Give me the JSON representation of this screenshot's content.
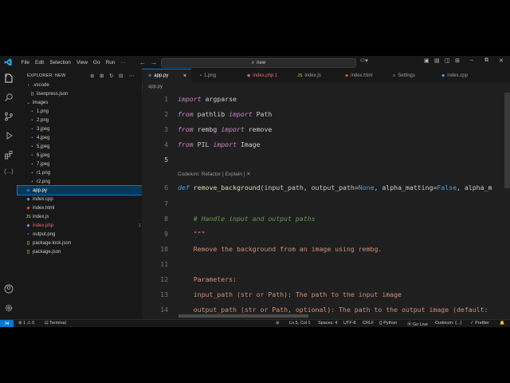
{
  "titlebar": {
    "menu": [
      "File",
      "Edit",
      "Selection",
      "View",
      "Go",
      "Run"
    ],
    "ellipsis": "···",
    "search_text": "new",
    "colors": {
      "accent": "#0078d4",
      "logo": "#23a9f2"
    }
  },
  "activity": {
    "icons": [
      "explorer-icon",
      "search-icon",
      "source-control-icon",
      "run-debug-icon",
      "extensions-icon",
      "codeium-icon",
      "account-icon",
      "manage-gear-icon"
    ]
  },
  "sidebar": {
    "title": "EXPLORER: NEW",
    "tree": [
      {
        "label": ".vscode",
        "icon": "›",
        "indent": 1,
        "type": "folder"
      },
      {
        "label": "iisexpress.json",
        "icon": "{}",
        "indent": 2,
        "type": "json"
      },
      {
        "label": "images",
        "icon": "⌄",
        "indent": 1,
        "type": "folder"
      },
      {
        "label": "1.png",
        "icon": "▪",
        "indent": 2,
        "type": "image"
      },
      {
        "label": "2.png",
        "icon": "▪",
        "indent": 2,
        "type": "image"
      },
      {
        "label": "3.jpeg",
        "icon": "▪",
        "indent": 2,
        "type": "image"
      },
      {
        "label": "4.jpeg",
        "icon": "▪",
        "indent": 2,
        "type": "image"
      },
      {
        "label": "5.jpeg",
        "icon": "▪",
        "indent": 2,
        "type": "image"
      },
      {
        "label": "6.jpeg",
        "icon": "▪",
        "indent": 2,
        "type": "image"
      },
      {
        "label": "7.jpeg",
        "icon": "▪",
        "indent": 2,
        "type": "image"
      },
      {
        "label": "r1.png",
        "icon": "▪",
        "indent": 2,
        "type": "image"
      },
      {
        "label": "r2.png",
        "icon": "▪",
        "indent": 2,
        "type": "image"
      },
      {
        "label": "app.py",
        "icon": "◆",
        "indent": 1,
        "type": "python",
        "selected": true
      },
      {
        "label": "index.cpp",
        "icon": "◆",
        "indent": 1,
        "type": "cpp"
      },
      {
        "label": "index.html",
        "icon": "◆",
        "indent": 1,
        "type": "html"
      },
      {
        "label": "index.js",
        "icon": "JS",
        "indent": 1,
        "type": "js"
      },
      {
        "label": "index.php",
        "icon": "◆",
        "indent": 1,
        "type": "php",
        "badge": "1"
      },
      {
        "label": "output.png",
        "icon": "▪",
        "indent": 1,
        "type": "image"
      },
      {
        "label": "package-lock.json",
        "icon": "{}",
        "indent": 1,
        "type": "json"
      },
      {
        "label": "package.json",
        "icon": "{}",
        "indent": 1,
        "type": "json"
      }
    ]
  },
  "tabs": [
    {
      "label": "app.py",
      "icon": "◆",
      "active": true,
      "close": "×"
    },
    {
      "label": "1.png",
      "icon": "▪"
    },
    {
      "label": "index.php 1",
      "icon": "◆",
      "error": true
    },
    {
      "label": "index.js",
      "icon": "JS"
    },
    {
      "label": "index.html",
      "icon": "◆"
    },
    {
      "label": "Settings",
      "icon": "≡"
    },
    {
      "label": "index.cpp",
      "icon": "◆"
    }
  ],
  "breadcrumb": "app.py",
  "editor": {
    "lines": [
      {
        "n": "1",
        "tokens": [
          {
            "t": "import",
            "c": "kw-imp"
          },
          {
            "t": " argparse"
          }
        ]
      },
      {
        "n": "2",
        "tokens": [
          {
            "t": "from",
            "c": "kw-imp"
          },
          {
            "t": " pathlib "
          },
          {
            "t": "import",
            "c": "kw-imp"
          },
          {
            "t": " Path"
          }
        ]
      },
      {
        "n": "3",
        "tokens": [
          {
            "t": "from",
            "c": "kw-imp"
          },
          {
            "t": " rembg "
          },
          {
            "t": "import",
            "c": "kw-imp"
          },
          {
            "t": " remove"
          }
        ]
      },
      {
        "n": "4",
        "tokens": [
          {
            "t": "from",
            "c": "kw-imp"
          },
          {
            "t": " PIL "
          },
          {
            "t": "import",
            "c": "kw-imp"
          },
          {
            "t": " Image"
          }
        ]
      },
      {
        "n": "5",
        "tokens": [],
        "current": true
      },
      {
        "n": "6",
        "tokens": [
          {
            "t": "def",
            "c": "kw-def"
          },
          {
            "t": " "
          },
          {
            "t": "remove_background",
            "c": "fn"
          },
          {
            "t": "(input_path, output_path="
          },
          {
            "t": "None",
            "c": "kwc"
          },
          {
            "t": ", alpha_matting="
          },
          {
            "t": "False",
            "c": "kwc"
          },
          {
            "t": ", alpha_m"
          }
        ]
      },
      {
        "n": "7",
        "tokens": []
      },
      {
        "n": "8",
        "tokens": [
          {
            "t": "    "
          },
          {
            "t": "# Handle input and output paths",
            "c": "cmt"
          }
        ]
      },
      {
        "n": "9",
        "tokens": [
          {
            "t": "    "
          },
          {
            "t": "\"\"\"",
            "c": "str"
          }
        ]
      },
      {
        "n": "10",
        "tokens": [
          {
            "t": "    Remove the background from an image using rembg.",
            "c": "str"
          }
        ]
      },
      {
        "n": "11",
        "tokens": []
      },
      {
        "n": "12",
        "tokens": [
          {
            "t": "    Parameters:",
            "c": "str"
          }
        ]
      },
      {
        "n": "13",
        "tokens": [
          {
            "t": "    input_path (str or Path): The path to the input image",
            "c": "str"
          }
        ]
      },
      {
        "n": "14",
        "tokens": [
          {
            "t": "    output_path (str or Path, optional): The path to the output image (default:",
            "c": "str"
          }
        ]
      }
    ],
    "codelens": "Codeium: Refactor | Explain | ✕"
  },
  "status": {
    "remote": "⋊",
    "problems": "⊗ 1 ⚠ 0",
    "terminal": "⊡ Terminal",
    "zoom": "⊖",
    "position": "Ln 5, Col 1",
    "spaces": "Spaces: 4",
    "encoding": "UTF-8",
    "eol": "CRLF",
    "language": "{} Python",
    "golive": "⦿ Go Live",
    "codeium": "Codeium: {...}",
    "prettier": "✓ Prettier",
    "bell": "🔔"
  }
}
